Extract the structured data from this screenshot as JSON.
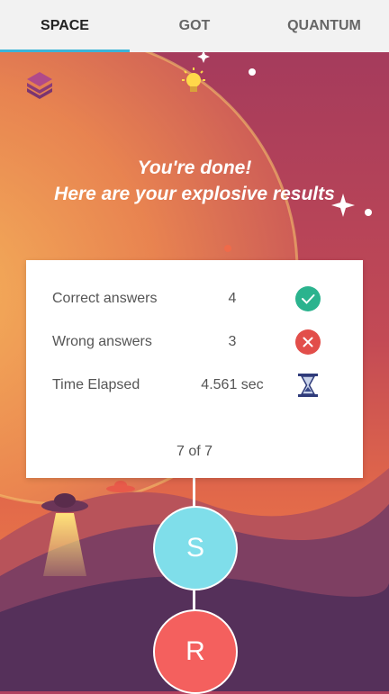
{
  "tabs": [
    {
      "label": "SPACE",
      "active": true
    },
    {
      "label": "GOT",
      "active": false
    },
    {
      "label": "QUANTUM",
      "active": false
    }
  ],
  "headline": {
    "line1": "You're done!",
    "line2": "Here are your explosive results"
  },
  "results": [
    {
      "label": "Correct answers",
      "value": "4",
      "icon": "check-icon"
    },
    {
      "label": "Wrong answers",
      "value": "3",
      "icon": "cross-icon"
    },
    {
      "label": "Time Elapsed",
      "value": "4.561 sec",
      "icon": "hourglass-icon"
    }
  ],
  "progress": "7 of 7",
  "nav_buttons": [
    {
      "letter": "S",
      "color": "#7fdeea"
    },
    {
      "letter": "R",
      "color": "#f4605e"
    }
  ],
  "colors": {
    "tab_indicator": "#3bb4d8",
    "correct": "#2bb38e",
    "wrong": "#e24e4a",
    "hourglass": "#2f3b7a"
  }
}
